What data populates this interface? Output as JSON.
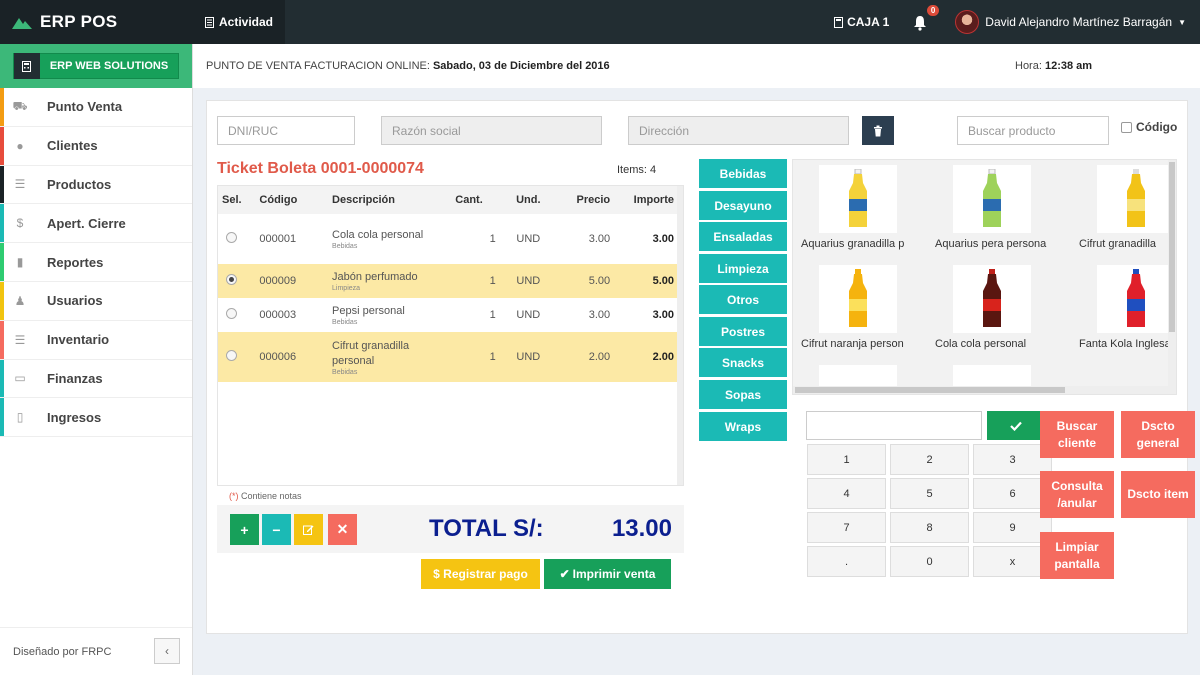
{
  "topbar": {
    "brand": "ERP POS",
    "activity": "Actividad",
    "caja": "CAJA 1",
    "notifications_count": "0",
    "user_name": "David Alejandro Martínez Barragán"
  },
  "sidebar": {
    "header_button": "ERP WEB SOLUTIONS",
    "items": [
      {
        "label": "Punto Venta",
        "icon": "cart-icon",
        "color": "#f39c12"
      },
      {
        "label": "Clientes",
        "icon": "user-icon",
        "color": "#e74c3c"
      },
      {
        "label": "Productos",
        "icon": "list-icon",
        "color": "#1a2226"
      },
      {
        "label": "Apert. Cierre",
        "icon": "dollar-icon",
        "color": "#1bbab5"
      },
      {
        "label": "Reportes",
        "icon": "bar-chart-icon",
        "color": "#2ecc71"
      },
      {
        "label": "Usuarios",
        "icon": "person-icon",
        "color": "#f1c40f"
      },
      {
        "label": "Inventario",
        "icon": "list-icon",
        "color": "#f56b5f"
      },
      {
        "label": "Finanzas",
        "icon": "money-icon",
        "color": "#1bbab5"
      },
      {
        "label": "Ingresos",
        "icon": "building-icon",
        "color": "#1bbab5"
      }
    ],
    "footer": "Diseñado por FRPC"
  },
  "subheader": {
    "label": "PUNTO DE VENTA FACTURACION ONLINE:",
    "date": "Sabado, 03 de Diciembre del 2016",
    "hora_label": "Hora:",
    "hora": "12:38 am"
  },
  "form": {
    "dni_placeholder": "DNI/RUC",
    "razon_placeholder": "Razón social",
    "direccion_placeholder": "Dirección",
    "buscar_placeholder": "Buscar producto",
    "codigo_label": "Código"
  },
  "ticket": {
    "title": "Ticket Boleta 0001-0000074",
    "items_count": "Items: 4",
    "columns": [
      "Sel.",
      "Código",
      "Descripción",
      "Cant.",
      "Und.",
      "Precio",
      "Importe"
    ],
    "rows": [
      {
        "selected": false,
        "code": "000001",
        "desc": "Cola cola personal",
        "category": "Bebidas",
        "qty": "1",
        "unit": "UND",
        "price": "3.00",
        "amount": "3.00"
      },
      {
        "selected": true,
        "code": "000009",
        "desc": "Jabón perfumado",
        "category": "Limpieza",
        "qty": "1",
        "unit": "UND",
        "price": "5.00",
        "amount": "5.00"
      },
      {
        "selected": false,
        "code": "000003",
        "desc": "Pepsi personal",
        "category": "Bebidas",
        "qty": "1",
        "unit": "UND",
        "price": "3.00",
        "amount": "3.00"
      },
      {
        "selected": false,
        "code": "000006",
        "desc": "Cifrut granadilla personal",
        "category": "Bebidas",
        "qty": "1",
        "unit": "UND",
        "price": "2.00",
        "amount": "2.00"
      }
    ],
    "note_mark": "(*)",
    "note": "Contiene notas",
    "total_label": "TOTAL S/:",
    "total_value": "13.00"
  },
  "actions": {
    "registrar": "$ Registrar pago",
    "imprimir": "Imprimir venta"
  },
  "categories": [
    "Bebidas",
    "Desayuno",
    "Ensaladas",
    "Limpieza",
    "Otros",
    "Postres",
    "Snacks",
    "Sopas",
    "Wraps"
  ],
  "products": [
    {
      "name": "Aquarius granadilla p",
      "color": "#f4d23a"
    },
    {
      "name": "Aquarius pera persona",
      "color": "#9ed25a"
    },
    {
      "name": "Cifrut granadilla",
      "color": "#f2c318"
    },
    {
      "name": "Cifrut naranja person",
      "color": "#f5b30e"
    },
    {
      "name": "Cola cola personal",
      "color": "#6b1a12"
    },
    {
      "name": "Fanta Kola Inglesa",
      "color": "#e0202a"
    }
  ],
  "keypad": {
    "keys": [
      "1",
      "2",
      "3",
      "4",
      "5",
      "6",
      "7",
      "8",
      "9",
      ".",
      "0",
      "x"
    ]
  },
  "side_buttons": {
    "buscar_cliente": "Buscar cliente",
    "dscto_general": "Dscto general",
    "consulta_anular": "Consulta /anular",
    "dscto_item": "Dscto item",
    "limpiar_pantalla": "Limpiar pantalla"
  },
  "colors": {
    "topbar": "#222d32",
    "green": "#17a05a",
    "teal": "#1bbab5",
    "yellow": "#f5c412",
    "red": "#f56b5f",
    "highlight_row": "#fce9a5",
    "total": "#0b1f8f"
  }
}
